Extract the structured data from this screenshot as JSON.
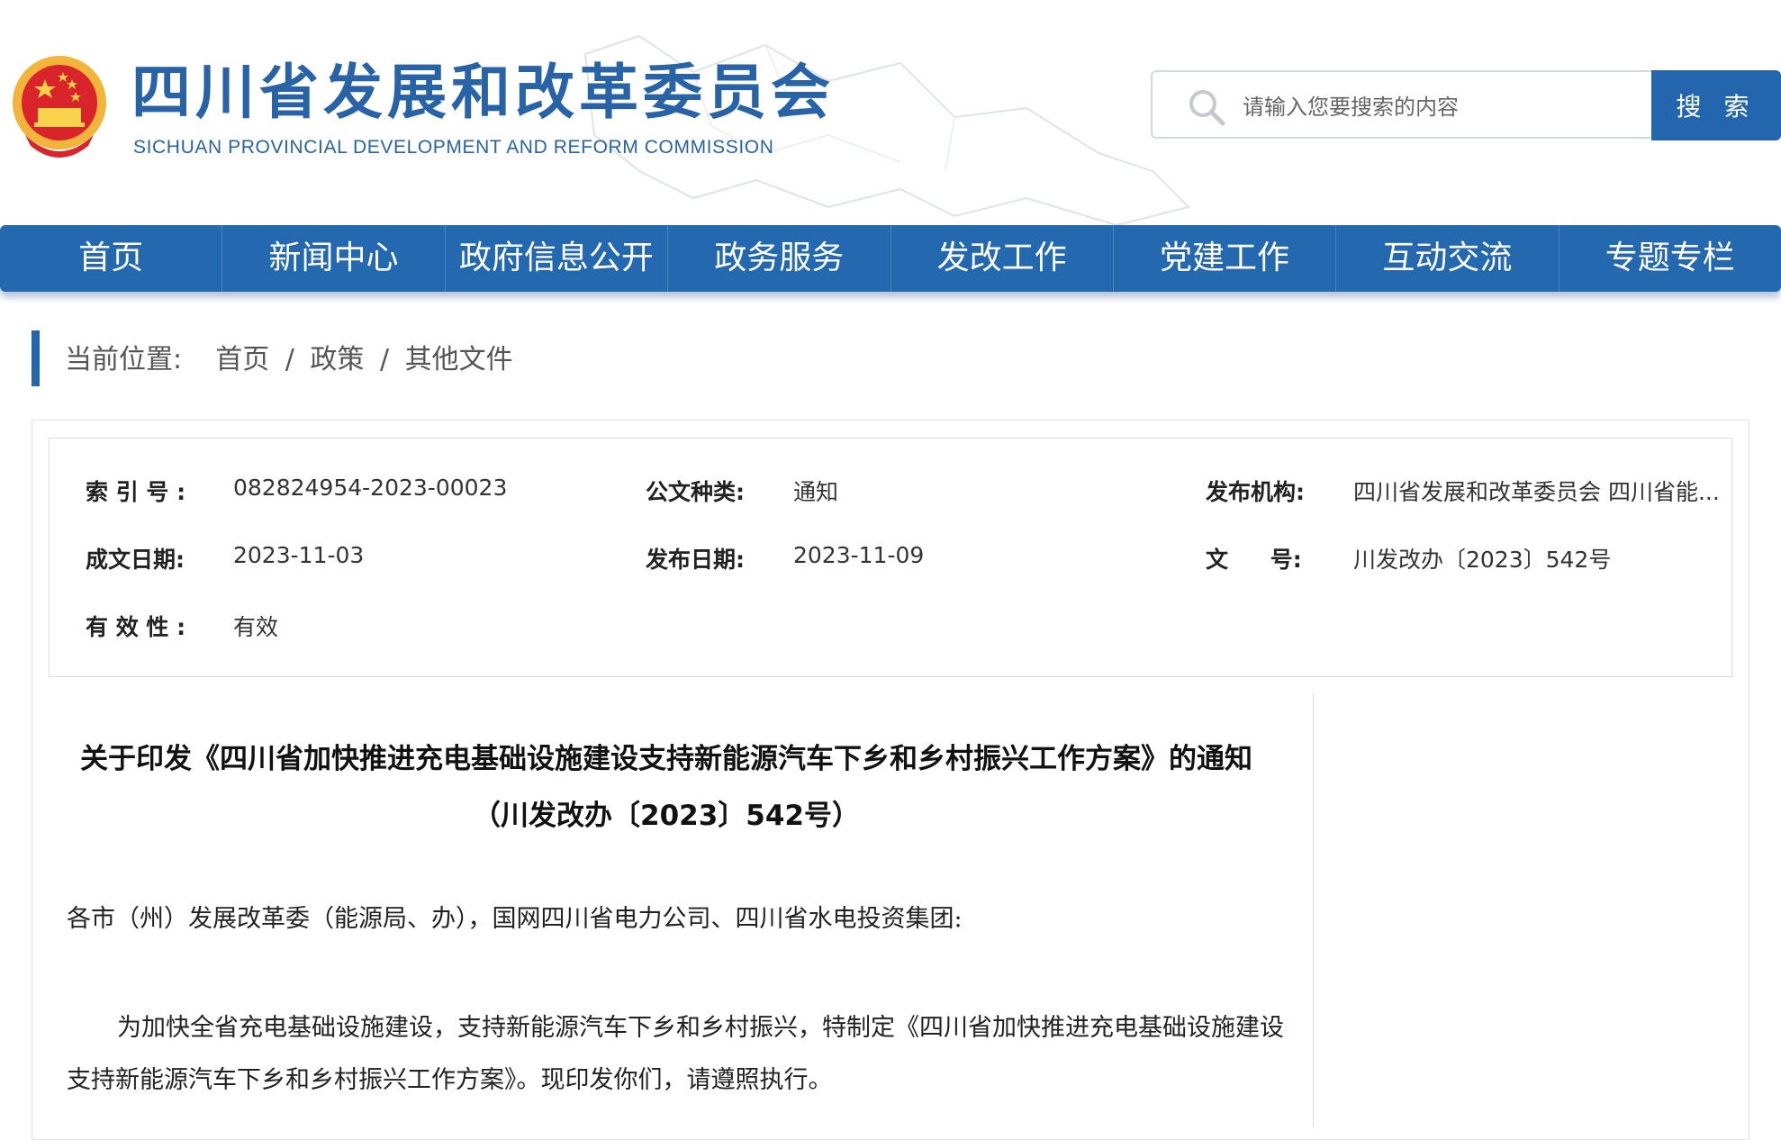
{
  "header": {
    "org_name_cn": "四川省发展和改革委员会",
    "org_name_en": "SICHUAN PROVINCIAL DEVELOPMENT AND REFORM COMMISSION",
    "search": {
      "placeholder": "请输入您要搜索的内容",
      "button_label": "搜 索"
    },
    "colors": {
      "brand_blue": "#2863a8",
      "nav_blue": "#2468b0"
    }
  },
  "nav": {
    "items": [
      {
        "label": "首页"
      },
      {
        "label": "新闻中心"
      },
      {
        "label": "政府信息公开"
      },
      {
        "label": "政务服务"
      },
      {
        "label": "发改工作"
      },
      {
        "label": "党建工作"
      },
      {
        "label": "互动交流"
      },
      {
        "label": "专题专栏"
      }
    ]
  },
  "breadcrumb": {
    "prefix": "当前位置:",
    "items": [
      "首页",
      "政策",
      "其他文件"
    ],
    "separator": "/"
  },
  "meta": {
    "index_no": {
      "label": "索 引 号 :",
      "value": "082824954-2023-00023"
    },
    "doc_type": {
      "label": "公文种类:",
      "value": "通知"
    },
    "publisher": {
      "label": "发布机构:",
      "value": "四川省发展和改革委员会 四川省能..."
    },
    "created_date": {
      "label": "成文日期:",
      "value": "2023-11-03"
    },
    "publish_date": {
      "label": "发布日期:",
      "value": "2023-11-09"
    },
    "doc_no": {
      "label": "文 号:",
      "value": "川发改办〔2023〕542号"
    },
    "validity": {
      "label": "有 效 性 :",
      "value": "有效"
    }
  },
  "document": {
    "title": "关于印发《四川省加快推进充电基础设施建设支持新能源汽车下乡和乡村振兴工作方案》的通知（川发改办〔2023〕542号）",
    "salutation": "各市（州）发展改革委（能源局、办），国网四川省电力公司、四川省水电投资集团:",
    "paragraph": "为加快全省充电基础设施建设，支持新能源汽车下乡和乡村振兴，特制定《四川省加快推进充电基础设施建设支持新能源汽车下乡和乡村振兴工作方案》。现印发你们，请遵照执行。"
  }
}
